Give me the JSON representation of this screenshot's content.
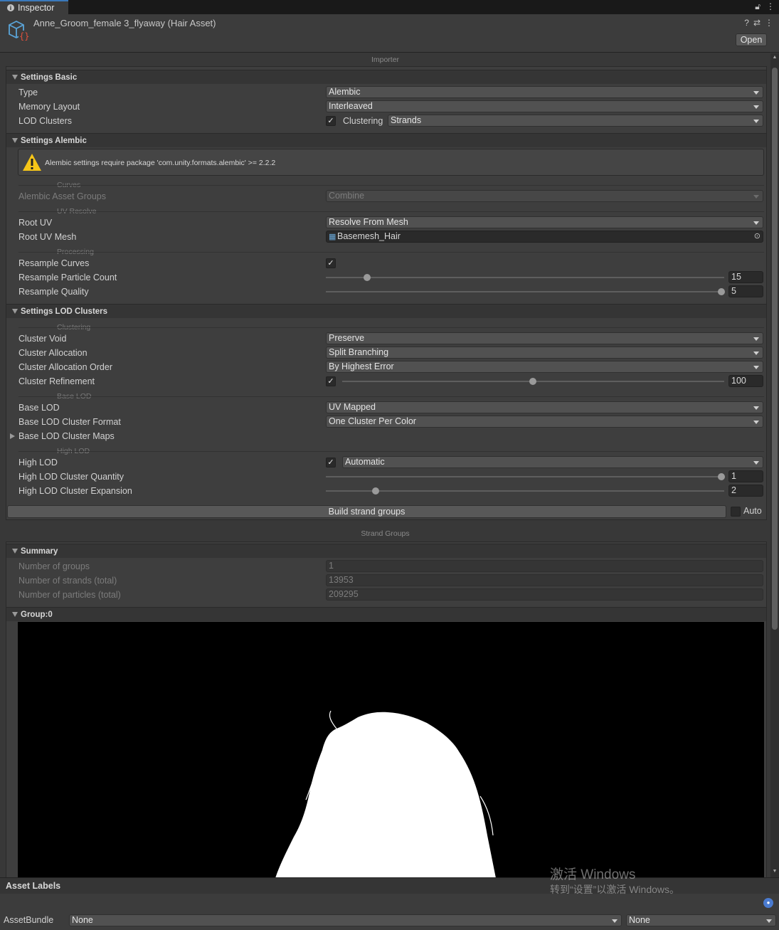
{
  "tab": {
    "label": "Inspector"
  },
  "header": {
    "asset_title": "Anne_Groom_female 3_flyaway (Hair Asset)",
    "open_label": "Open"
  },
  "importer": {
    "caption": "Importer",
    "settings_basic": {
      "title": "Settings Basic",
      "type_label": "Type",
      "type_value": "Alembic",
      "memory_label": "Memory Layout",
      "memory_value": "Interleaved",
      "lod_label": "LOD Clusters",
      "lod_checked": "✓",
      "clustering_label": "Clustering",
      "clustering_value": "Strands"
    },
    "settings_alembic": {
      "title": "Settings Alembic",
      "warning": "Alembic settings require package 'com.unity.formats.alembic' >= 2.2.2",
      "curves_sub": "Curves",
      "groups_label": "Alembic Asset Groups",
      "groups_value": "Combine",
      "uv_sub": "UV Resolve",
      "root_uv_label": "Root UV",
      "root_uv_value": "Resolve From Mesh",
      "root_uv_mesh_label": "Root UV Mesh",
      "root_uv_mesh_value": "Basemesh_Hair",
      "processing_sub": "Processing",
      "resample_curves_label": "Resample Curves",
      "resample_curves_checked": "✓",
      "resample_count_label": "Resample Particle Count",
      "resample_count_value": "15",
      "resample_quality_label": "Resample Quality",
      "resample_quality_value": "5"
    },
    "settings_lod": {
      "title": "Settings LOD Clusters",
      "clustering_sub": "Clustering",
      "void_label": "Cluster Void",
      "void_value": "Preserve",
      "alloc_label": "Cluster Allocation",
      "alloc_value": "Split Branching",
      "alloc_order_label": "Cluster Allocation Order",
      "alloc_order_value": "By Highest Error",
      "refine_label": "Cluster Refinement",
      "refine_checked": "✓",
      "refine_value": "100",
      "base_lod_sub": "Base LOD",
      "base_lod_label": "Base LOD",
      "base_lod_value": "UV Mapped",
      "base_format_label": "Base LOD Cluster Format",
      "base_format_value": "One Cluster Per Color",
      "base_maps_label": "Base LOD Cluster Maps",
      "high_lod_sub": "High LOD",
      "high_lod_label": "High LOD",
      "high_lod_checked": "✓",
      "high_lod_value": "Automatic",
      "high_qty_label": "High LOD Cluster Quantity",
      "high_qty_value": "1",
      "high_exp_label": "High LOD Cluster Expansion",
      "high_exp_value": "2"
    },
    "build_label": "Build strand groups",
    "auto_label": "Auto"
  },
  "strand_groups": {
    "caption": "Strand Groups",
    "summary_title": "Summary",
    "groups_label": "Number of groups",
    "groups_value": "1",
    "strands_label": "Number of strands (total)",
    "strands_value": "13953",
    "particles_label": "Number of particles (total)",
    "particles_value": "209295",
    "group_title": "Group:0"
  },
  "asset_labels": {
    "title": "Asset Labels",
    "bundle_label": "AssetBundle",
    "bundle_value": "None",
    "variant_value": "None"
  },
  "watermark": {
    "line1": "激活 Windows",
    "line2": "转到“设置”以激活 Windows。"
  }
}
